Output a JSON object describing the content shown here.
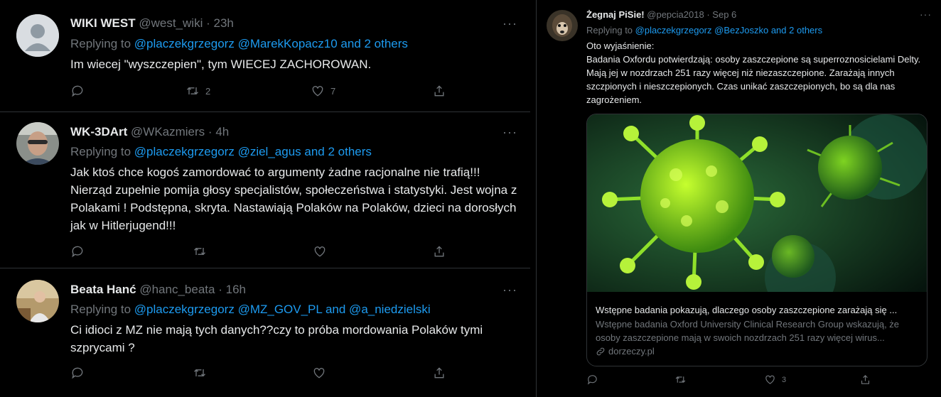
{
  "tweets": [
    {
      "name": "WIKI WEST",
      "handle": "@west_wiki",
      "sep": "·",
      "time": "23h",
      "more": "···",
      "replying_prefix": "Replying to ",
      "mention1": "@placzekgrzegorz",
      "mention2": "@MarekKopacz10",
      "others": "and 2 others",
      "body": "Im wiecej \"wyszczepien\", tym WIECEJ ZACHOROWAN.",
      "retweets": "2",
      "likes": "7",
      "avatar": "default-person-avatar"
    },
    {
      "name": "WK-3DArt",
      "handle": "@WKazmiers",
      "sep": "·",
      "time": "4h",
      "more": "···",
      "replying_prefix": "Replying to ",
      "mention1": "@placzekgrzegorz",
      "mention2": "@ziel_agus",
      "others": "and 2 others",
      "body": "Jak ktoś chce kogoś zamordować to argumenty żadne racjonalne nie trafią!!! Nierząd zupełnie pomija głosy specjalistów, społeczeństwa i statystyki. Jest wojna z Polakami ! Podstępna, skryta. Nastawiają Polaków na Polaków, dzieci na dorosłych jak w Hitlerjugend!!!",
      "retweets": "",
      "likes": "",
      "avatar": "photo-avatar"
    },
    {
      "name": "Beata Hanć",
      "handle": "@hanc_beata",
      "sep": "·",
      "time": "16h",
      "more": "···",
      "replying_prefix": "Replying to ",
      "mention1": "@placzekgrzegorz",
      "mention2": "@MZ_GOV_PL",
      "others": "and @a_niedzielski",
      "body": "Ci idioci z MZ nie mają tych danych??czy to próba mordowania Polaków tymi szprycami ?",
      "retweets": "",
      "likes": "",
      "avatar": "photo-avatar"
    }
  ],
  "right_tweet": {
    "name": "Żegnaj PiSie!",
    "handle": "@pepcia2018",
    "sep": "·",
    "time": "Sep 6",
    "more": "···",
    "replying_prefix": "Replying to ",
    "mention1": "@placzekgrzegorz",
    "mention2": "@BezJoszko",
    "others": "and 2 others",
    "body_line1": "Oto wyjaśnienie:",
    "body_rest": "Badania Oxfordu potwierdzają: osoby zaszczepione są superroznosicielami Delty. Mają jej w nozdrzach 251 razy więcej niż niezaszczepione. Zarażają innych szczpionych i nieszczepionych. Czas unikać zaszczepionych, bo są dla nas zagrożeniem.",
    "card": {
      "title": "Wstępne badania pokazują, dlaczego osoby zaszczepione zarażają się ...",
      "desc": "Wstępne badania Oxford University Clinical Research Group wskazują, że osoby zaszczepione mają w swoich nozdrzach 251 razy więcej wirus...",
      "domain": "dorzeczy.pl"
    },
    "likes": "3"
  },
  "colors": {
    "background": "#000000",
    "link": "#1d9bf0",
    "muted": "#71767b",
    "text": "#e7e9ea",
    "border": "#2f3336"
  }
}
